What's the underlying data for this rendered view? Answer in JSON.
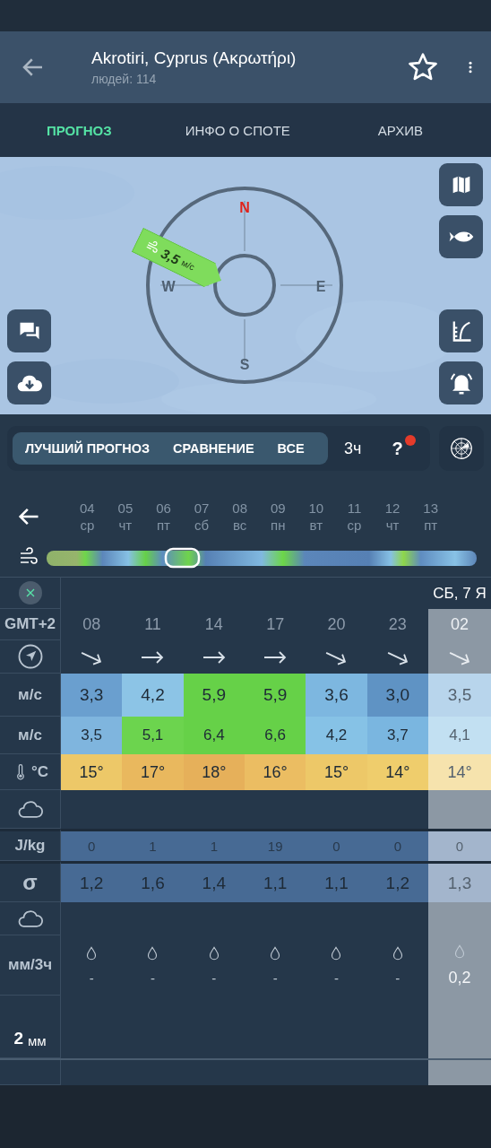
{
  "header": {
    "title": "Akrotiri, Cyprus (Ακρωτήρι)",
    "subtitle": "людей: 114",
    "favorite": false
  },
  "tabs": [
    {
      "label": "ПРОГНОЗ",
      "selected": true
    },
    {
      "label": "ИНФО О СПОТЕ",
      "selected": false
    },
    {
      "label": "АРХИВ",
      "selected": false
    }
  ],
  "compass": {
    "north": "N",
    "east": "E",
    "south": "S",
    "west": "W",
    "wind_speed": "3,5",
    "wind_unit": "м/с"
  },
  "modes": [
    "ЛУЧШИЙ ПРОГНОЗ",
    "СРАВНЕНИЕ",
    "ВСЕ"
  ],
  "interval": "3ч",
  "help": {
    "label": "?",
    "notification": true
  },
  "days": [
    {
      "date": "04",
      "weekday": "ср"
    },
    {
      "date": "05",
      "weekday": "чт"
    },
    {
      "date": "06",
      "weekday": "пт"
    },
    {
      "date": "07",
      "weekday": "сб"
    },
    {
      "date": "08",
      "weekday": "вс"
    },
    {
      "date": "09",
      "weekday": "пн"
    },
    {
      "date": "10",
      "weekday": "вт"
    },
    {
      "date": "11",
      "weekday": "ср"
    },
    {
      "date": "12",
      "weekday": "чт"
    },
    {
      "date": "13",
      "weekday": "пт"
    }
  ],
  "table": {
    "day_heading": "СБ, 7 Я",
    "timezone": "GMT+2",
    "wind_unit": "м/с",
    "gust_unit": "м/с",
    "temp_unit": "°C",
    "cape_unit": "J/kg",
    "wave_label": "σ",
    "precip_unit": "мм/3ч",
    "scale_label": "**2** мм",
    "columns": [
      {
        "time": "08",
        "direction": {
          "kind": "down-right"
        },
        "wind": {
          "value": "3,3",
          "color": "#6a9fcf"
        },
        "gust": {
          "value": "3,5",
          "color": "#7fb5de"
        },
        "temp": {
          "value": "15°",
          "color": "#edc868"
        },
        "cape": "0",
        "waves": "1,2",
        "precip": "-",
        "dimmed": false
      },
      {
        "time": "11",
        "direction": {
          "kind": "right"
        },
        "wind": {
          "value": "4,2",
          "color": "#8cc4e6"
        },
        "gust": {
          "value": "5,1",
          "color": "#6cd44e"
        },
        "temp": {
          "value": "17°",
          "color": "#e9b85e"
        },
        "cape": "1",
        "waves": "1,6",
        "precip": "-",
        "dimmed": false
      },
      {
        "time": "14",
        "direction": {
          "kind": "right"
        },
        "wind": {
          "value": "5,9",
          "color": "#66d148"
        },
        "gust": {
          "value": "6,4",
          "color": "#66d148"
        },
        "temp": {
          "value": "18°",
          "color": "#e6b05a"
        },
        "cape": "1",
        "waves": "1,4",
        "precip": "-",
        "dimmed": false
      },
      {
        "time": "17",
        "direction": {
          "kind": "right"
        },
        "wind": {
          "value": "5,9",
          "color": "#66d148"
        },
        "gust": {
          "value": "6,6",
          "color": "#66d148"
        },
        "temp": {
          "value": "16°",
          "color": "#ebbd62"
        },
        "cape": "19",
        "waves": "1,1",
        "precip": "-",
        "dimmed": false
      },
      {
        "time": "20",
        "direction": {
          "kind": "down-right"
        },
        "wind": {
          "value": "3,6",
          "color": "#7db7e0"
        },
        "gust": {
          "value": "4,2",
          "color": "#86c2e6"
        },
        "temp": {
          "value": "15°",
          "color": "#edc868"
        },
        "cape": "0",
        "waves": "1,1",
        "precip": "-",
        "dimmed": false
      },
      {
        "time": "23",
        "direction": {
          "kind": "down-right"
        },
        "wind": {
          "value": "3,0",
          "color": "#5f93c4"
        },
        "gust": {
          "value": "3,7",
          "color": "#7ab6e0"
        },
        "temp": {
          "value": "14°",
          "color": "#efcd6c"
        },
        "cape": "0",
        "waves": "1,2",
        "precip": "-",
        "dimmed": false
      },
      {
        "time": "02",
        "direction": {
          "kind": "down-right"
        },
        "wind": {
          "value": "3,5",
          "color": "#b8d5ec"
        },
        "gust": {
          "value": "4,1",
          "color": "#c2e0f2"
        },
        "temp": {
          "value": "14°",
          "color": "#f6e3ad"
        },
        "cape": "0",
        "waves": "1,3",
        "precip": "0,2",
        "dimmed": true
      }
    ]
  }
}
